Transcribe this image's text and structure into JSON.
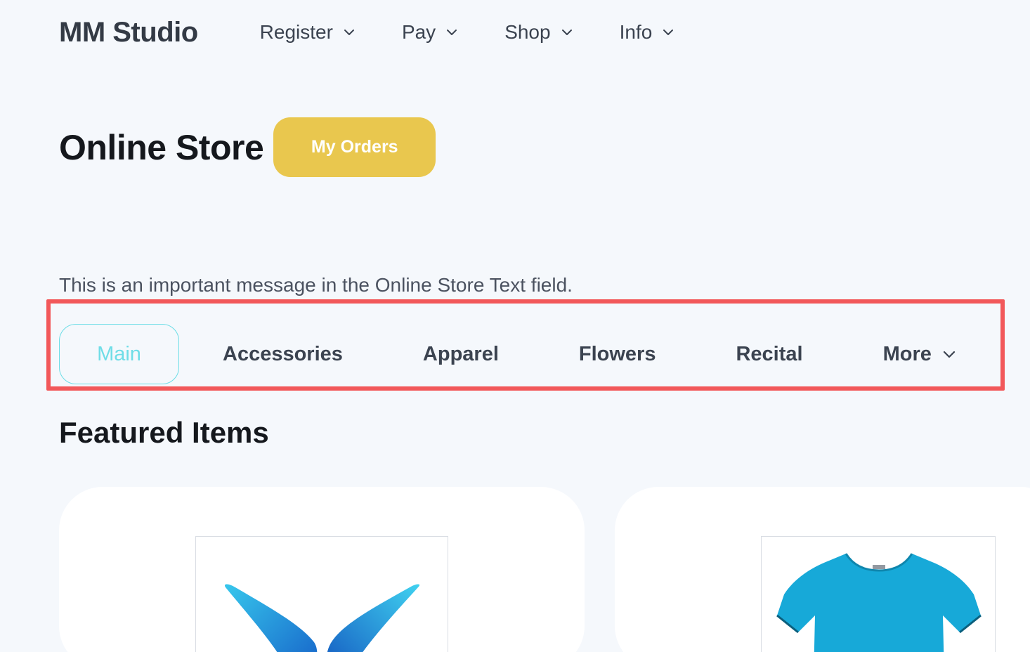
{
  "header": {
    "brand": "MM Studio",
    "nav": [
      {
        "label": "Register",
        "icon": "chevron-down-icon"
      },
      {
        "label": "Pay",
        "icon": "chevron-down-icon"
      },
      {
        "label": "Shop",
        "icon": "chevron-down-icon"
      },
      {
        "label": "Info",
        "icon": "chevron-down-icon"
      }
    ]
  },
  "main": {
    "title": "Online Store",
    "orders_button": "My Orders",
    "message": "This is an important message in the Online Store Text field.",
    "categories": [
      {
        "label": "Main",
        "active": true
      },
      {
        "label": "Accessories",
        "active": false
      },
      {
        "label": "Apparel",
        "active": false
      },
      {
        "label": "Flowers",
        "active": false
      },
      {
        "label": "Recital",
        "active": false
      },
      {
        "label": "More",
        "active": false,
        "icon": "chevron-down-icon"
      }
    ],
    "section_title": "Featured Items"
  },
  "products": [
    {
      "image": "blue-wings-logo"
    },
    {
      "image": "blue-tshirt"
    }
  ],
  "colors": {
    "accent_yellow": "#e9c74e",
    "active_tab": "#6fdde7",
    "highlight_box": "#f2585a",
    "background": "#f5f8fc"
  }
}
